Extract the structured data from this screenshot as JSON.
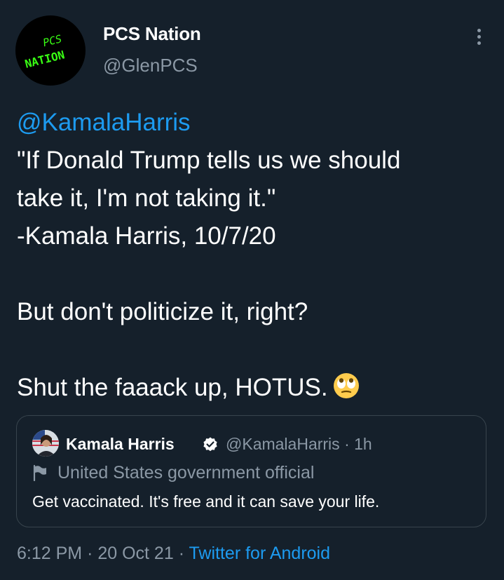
{
  "colors": {
    "background": "#15202b",
    "text": "#ffffff",
    "secondary_text": "#8b98a5",
    "accent": "#1d9bf0",
    "border": "#38444d",
    "avatar_logo": "#39ff14"
  },
  "author": {
    "display_name": "PCS Nation",
    "handle": "@GlenPCS",
    "avatar_text": [
      "PCS",
      "NATION"
    ],
    "more_icon": "more-vertical-icon"
  },
  "tweet": {
    "mention": "@KamalaHarris",
    "lines": [
      "\"If Donald Trump tells us we should",
      "take it, I'm not taking it.\"",
      "-Kamala Harris, 10/7/20"
    ],
    "line2": "But don't politicize it, right?",
    "line3": "Shut the faaack up, HOTUS.",
    "emoji": "face-with-rolling-eyes-emoji"
  },
  "quote": {
    "name": "Kamala Harris",
    "verified_icon": "verified-badge-icon",
    "handle": "@KamalaHarris",
    "separator": "·",
    "time": "1h",
    "label_icon": "flag-icon",
    "label": "United States government official",
    "text": "Get vaccinated. It's free and it can save your life."
  },
  "meta": {
    "time": "6:12 PM",
    "separator": "·",
    "date": "20 Oct 21",
    "source": "Twitter for Android"
  }
}
